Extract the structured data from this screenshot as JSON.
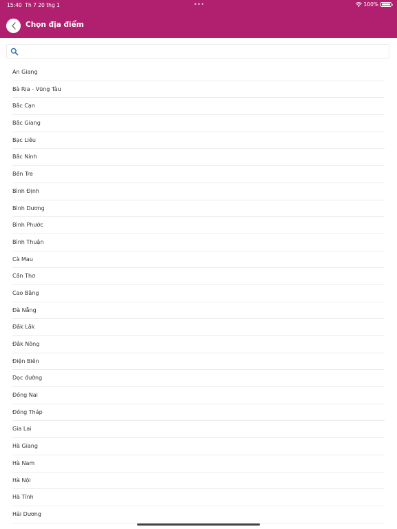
{
  "status_bar": {
    "time": "15:40",
    "date": "Th 7 20 thg 1",
    "dots": "•••",
    "battery": "100%"
  },
  "header": {
    "title": "Chọn địa điểm"
  },
  "search": {
    "placeholder": "",
    "value": ""
  },
  "locations": [
    "An Giang",
    "Bà Rịa - Vũng Tàu",
    "Bắc Cạn",
    "Bắc Giang",
    "Bạc Liêu",
    "Bắc Ninh",
    "Bến Tre",
    "Bình Định",
    "Bình Dương",
    "Bình Phước",
    "Bình Thuận",
    "Cà Mau",
    "Cần Thơ",
    "Cao Bằng",
    "Đà Nẵng",
    "Đắk Lắk",
    "Đắk Nông",
    "Điện Biên",
    "Dọc đường",
    "Đồng Nai",
    "Đồng Tháp",
    "Gia Lai",
    "Hà Giang",
    "Hà Nam",
    "Hà Nội",
    "Hà Tĩnh",
    "Hải Dương"
  ],
  "colors": {
    "header": "#b0206f",
    "search_icon": "#2f6fb4",
    "divider": "#ececec"
  },
  "icons": {
    "back": "chevron-left-icon",
    "search": "search-icon",
    "wifi": "wifi-icon",
    "battery": "battery-icon"
  }
}
